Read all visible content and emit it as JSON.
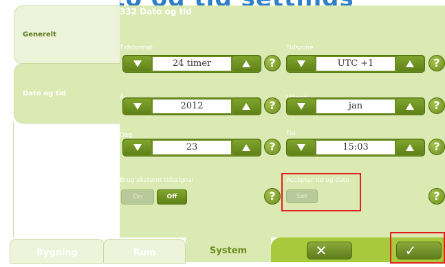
{
  "header_banner": {
    "partial_text_left": "",
    "partial_text_right": "Dato og tid settings"
  },
  "sidebar": {
    "items": [
      {
        "label": "Generelt",
        "selected": false
      },
      {
        "label": "Dato og tid",
        "selected": true
      }
    ]
  },
  "main": {
    "title": "332 Dato og tid",
    "fields": {
      "tidsformat": {
        "label": "Tidsformat",
        "value": "24 timer"
      },
      "tidszone": {
        "label": "Tidszone",
        "value": "UTC +1"
      },
      "aar": {
        "label": "År",
        "value": "2012"
      },
      "maaned": {
        "label": "Måned",
        "value": "jan"
      },
      "dag": {
        "label": "Dag",
        "value": "23"
      },
      "tid": {
        "label": "Tid",
        "value": "15:03"
      },
      "ekstern_signal": {
        "label": "Brug eksternt tidssignal",
        "on_label": "On",
        "off_label": "Off",
        "selected": "Off"
      },
      "accepter": {
        "label": "Accepter tid og dato",
        "button_label": "Sæt"
      }
    },
    "help_glyph": "?"
  },
  "bottom_tabs": [
    {
      "label": "Bygning"
    },
    {
      "label": "Rum"
    },
    {
      "label": "System",
      "selected": true
    }
  ],
  "actions": {
    "cancel_glyph": "✕",
    "confirm_glyph": "✓"
  },
  "colors": {
    "accent": "#6b8d1f",
    "panel": "#dbe9b2",
    "highlight": "#e11f1f",
    "action_bar": "#a7c93b"
  }
}
